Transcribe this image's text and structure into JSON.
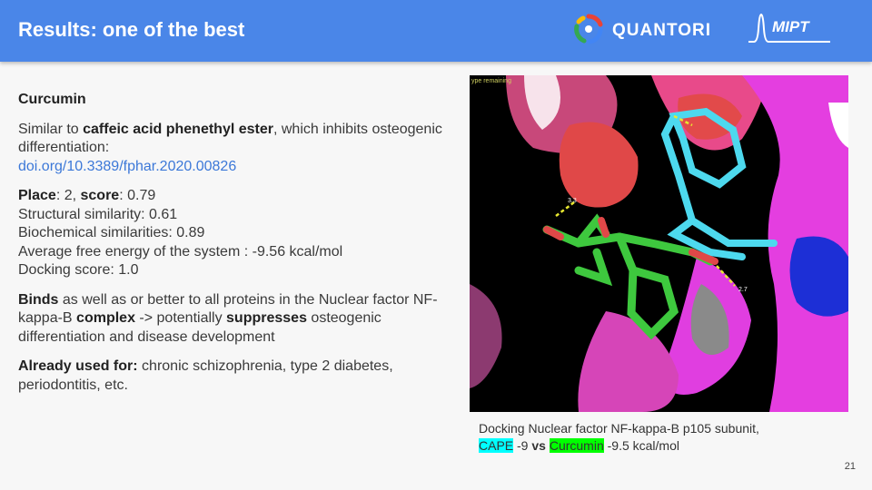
{
  "header": {
    "title": "Results: one of the best",
    "quantori_label": "QUANTORI",
    "mipt_label": "MIPT"
  },
  "content": {
    "heading": "Curcumin",
    "p1_prefix": "Similar to ",
    "p1_bold": "caffeic acid phenethyl ester",
    "p1_suffix": ", which inhibits osteogenic differentiation:",
    "doi_link": "doi.org/10.3389/fphar.2020.00826",
    "place_label": "Place",
    "place_value": ": 2, ",
    "score_label": "score",
    "score_value": ": 0.79",
    "structural": "Structural similarity: 0.61",
    "biochemical": "Biochemical similarities: 0.89",
    "free_energy": "Average free energy of the system : -9.56 kcal/mol",
    "docking_score": "Docking score: 1.0",
    "binds_label": "Binds",
    "binds_text1": " as well as or better to all proteins in the Nuclear factor NF-kappa-B ",
    "complex_label": "complex",
    "binds_text2": " -> potentially ",
    "suppresses_label": "suppresses",
    "binds_text3": " osteogenic differentiation and disease development",
    "used_label": "Already used for:",
    "used_text": " chronic schizophrenia, type 2 diabetes, periodontitis, etc."
  },
  "figure": {
    "corner_text": "ype remaining",
    "distance_labels": [
      "3.3",
      "2.7"
    ]
  },
  "caption": {
    "line1": "Docking Nuclear factor NF-kappa-B p105 subunit,",
    "cape": "CAPE",
    "cape_value": " -9 ",
    "vs": "vs",
    "space": " ",
    "curcumin": "Curcumin",
    "curcumin_value": " -9.5 kcal/mol"
  },
  "page_number": "21",
  "colors": {
    "header_bg": "#4a86e8",
    "link": "#3c78d8",
    "cape_highlight": "#00ffff",
    "curcumin_highlight": "#00ff00",
    "protein_surface": "#e83ee8",
    "ligand_cape": "#4dd9ee",
    "ligand_curcumin": "#3ec83e"
  }
}
